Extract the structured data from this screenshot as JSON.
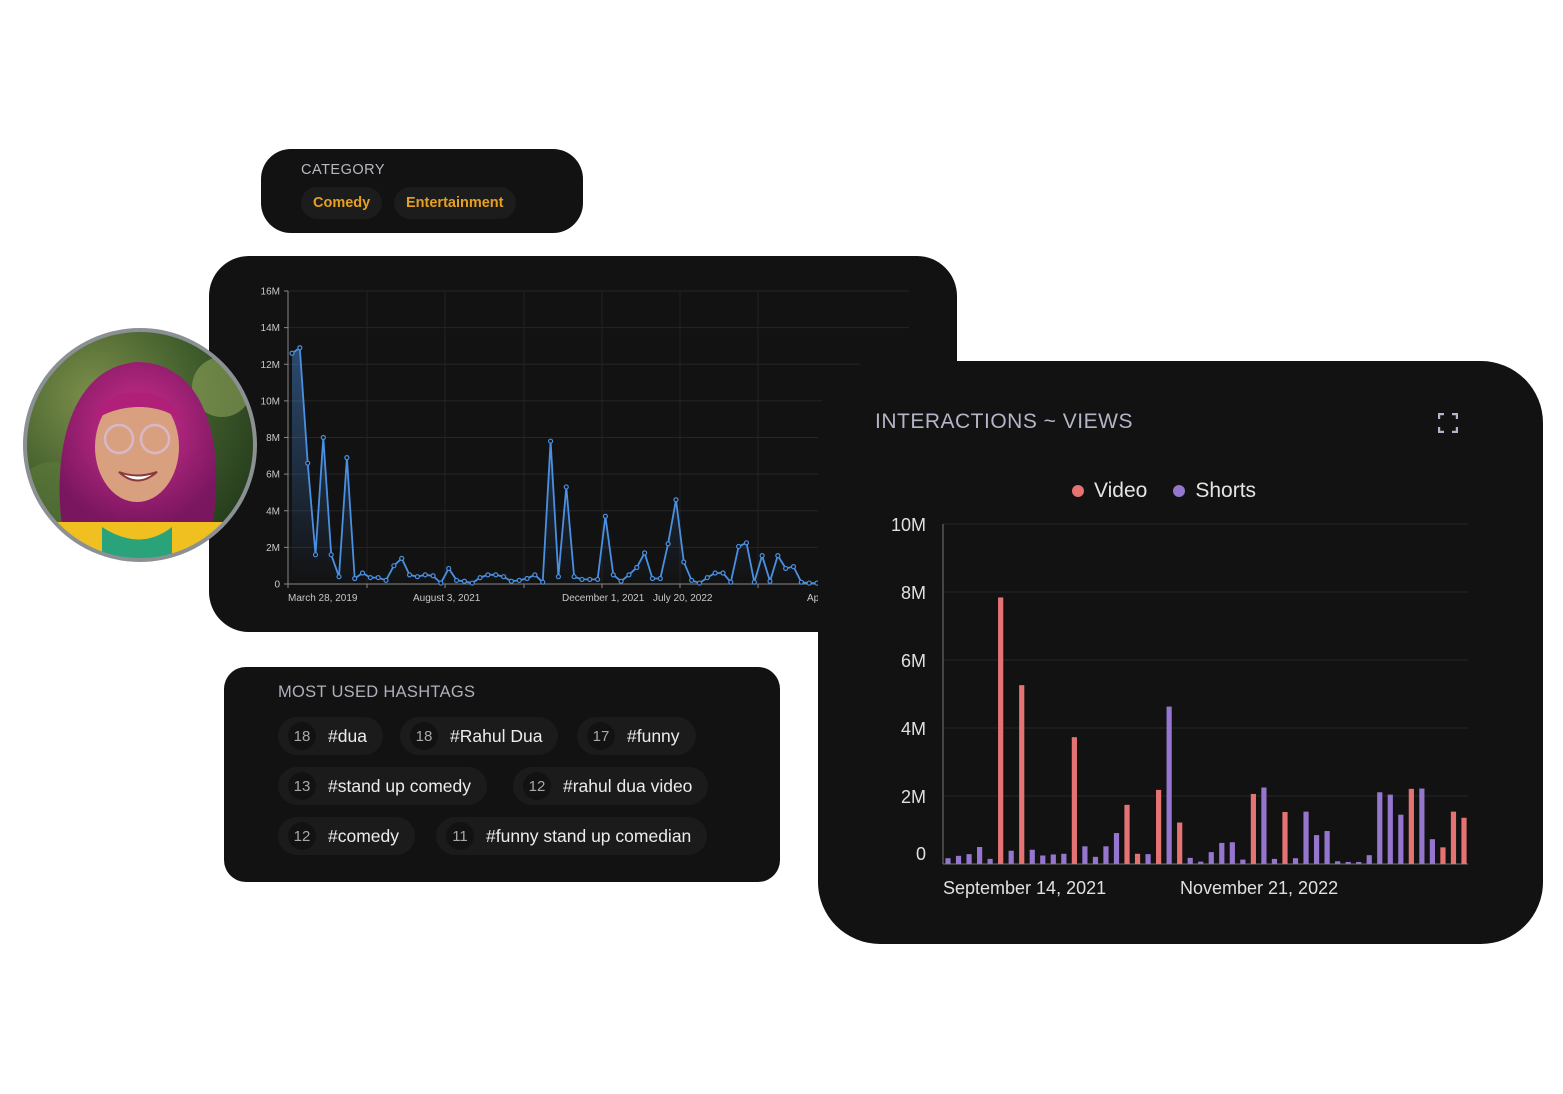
{
  "category": {
    "label": "CATEGORY",
    "tags": [
      "Comedy",
      "Entertainment"
    ],
    "tag_color": "#e6a020"
  },
  "hashtags": {
    "label": "MOST USED HASHTAGS",
    "items": [
      {
        "count": "18",
        "tag": "#dua"
      },
      {
        "count": "18",
        "tag": "#Rahul Dua"
      },
      {
        "count": "17",
        "tag": "#funny"
      },
      {
        "count": "13",
        "tag": "#stand up comedy"
      },
      {
        "count": "12",
        "tag": "#rahul dua video"
      },
      {
        "count": "12",
        "tag": "#comedy"
      },
      {
        "count": "11",
        "tag": "#funny stand up comedian"
      }
    ]
  },
  "interactions": {
    "title": "INTERACTIONS ~ VIEWS",
    "expand_icon": "expand-icon"
  },
  "avatar": {
    "icon": "profile-photo"
  },
  "chart_data": [
    {
      "type": "line",
      "title": "",
      "color": "#4a90e2",
      "ylim": [
        0,
        16
      ],
      "yticks": [
        "0",
        "2M",
        "4M",
        "6M",
        "8M",
        "10M",
        "12M",
        "14M",
        "16M"
      ],
      "xtick_labels": [
        "March 28, 2019",
        "August 3, 2021",
        "December 1, 2021",
        "July 20, 2022",
        "Ap"
      ],
      "grid": true,
      "values_millions": [
        12.6,
        12.9,
        6.6,
        1.6,
        8.0,
        1.6,
        0.4,
        6.9,
        0.3,
        0.6,
        0.35,
        0.35,
        0.2,
        1.0,
        1.4,
        0.5,
        0.4,
        0.5,
        0.45,
        0.05,
        0.85,
        0.2,
        0.15,
        0.05,
        0.35,
        0.5,
        0.5,
        0.4,
        0.15,
        0.2,
        0.3,
        0.5,
        0.1,
        7.8,
        0.4,
        5.3,
        0.4,
        0.25,
        0.25,
        0.25,
        3.7,
        0.5,
        0.15,
        0.5,
        0.9,
        1.7,
        0.3,
        0.3,
        2.2,
        4.6,
        1.2,
        0.2,
        0.05,
        0.35,
        0.6,
        0.6,
        0.1,
        2.05,
        2.25,
        0.1,
        1.55,
        0.15,
        1.55,
        0.85,
        0.95,
        0.1,
        0.05,
        0.05
      ]
    },
    {
      "type": "bar",
      "title": "INTERACTIONS ~ VIEWS",
      "ylim": [
        0,
        10
      ],
      "yticks": [
        "0",
        "2M",
        "4M",
        "6M",
        "8M",
        "10M"
      ],
      "xtick_labels": [
        "September 14, 2021",
        "November 21, 2022"
      ],
      "legend": "top-center",
      "grid": true,
      "series": [
        {
          "name": "Video",
          "color": "#e57373",
          "values_millions": [
            null,
            null,
            null,
            null,
            null,
            7.84,
            null,
            5.26,
            null,
            null,
            null,
            null,
            3.73,
            null,
            null,
            null,
            null,
            1.74,
            0.3,
            null,
            2.18,
            null,
            1.22,
            null,
            null,
            null,
            null,
            null,
            null,
            2.06,
            null,
            null,
            1.53,
            null,
            null,
            null,
            null,
            null,
            null,
            null,
            null,
            null,
            null,
            null,
            2.21,
            null,
            null,
            0.49,
            1.54,
            1.36
          ]
        },
        {
          "name": "Shorts",
          "color": "#9575cd",
          "values_millions": [
            0.17,
            0.24,
            0.29,
            0.5,
            0.15,
            null,
            0.39,
            null,
            0.42,
            0.25,
            0.28,
            0.3,
            null,
            0.52,
            0.21,
            0.52,
            0.91,
            null,
            null,
            0.29,
            null,
            4.63,
            null,
            0.18,
            0.07,
            0.35,
            0.62,
            0.64,
            0.13,
            null,
            2.25,
            0.15,
            null,
            0.17,
            1.54,
            0.85,
            0.97,
            0.08,
            0.06,
            0.06,
            0.26,
            2.11,
            2.04,
            1.45,
            null,
            2.22,
            0.73,
            null,
            null,
            null
          ]
        }
      ]
    }
  ]
}
